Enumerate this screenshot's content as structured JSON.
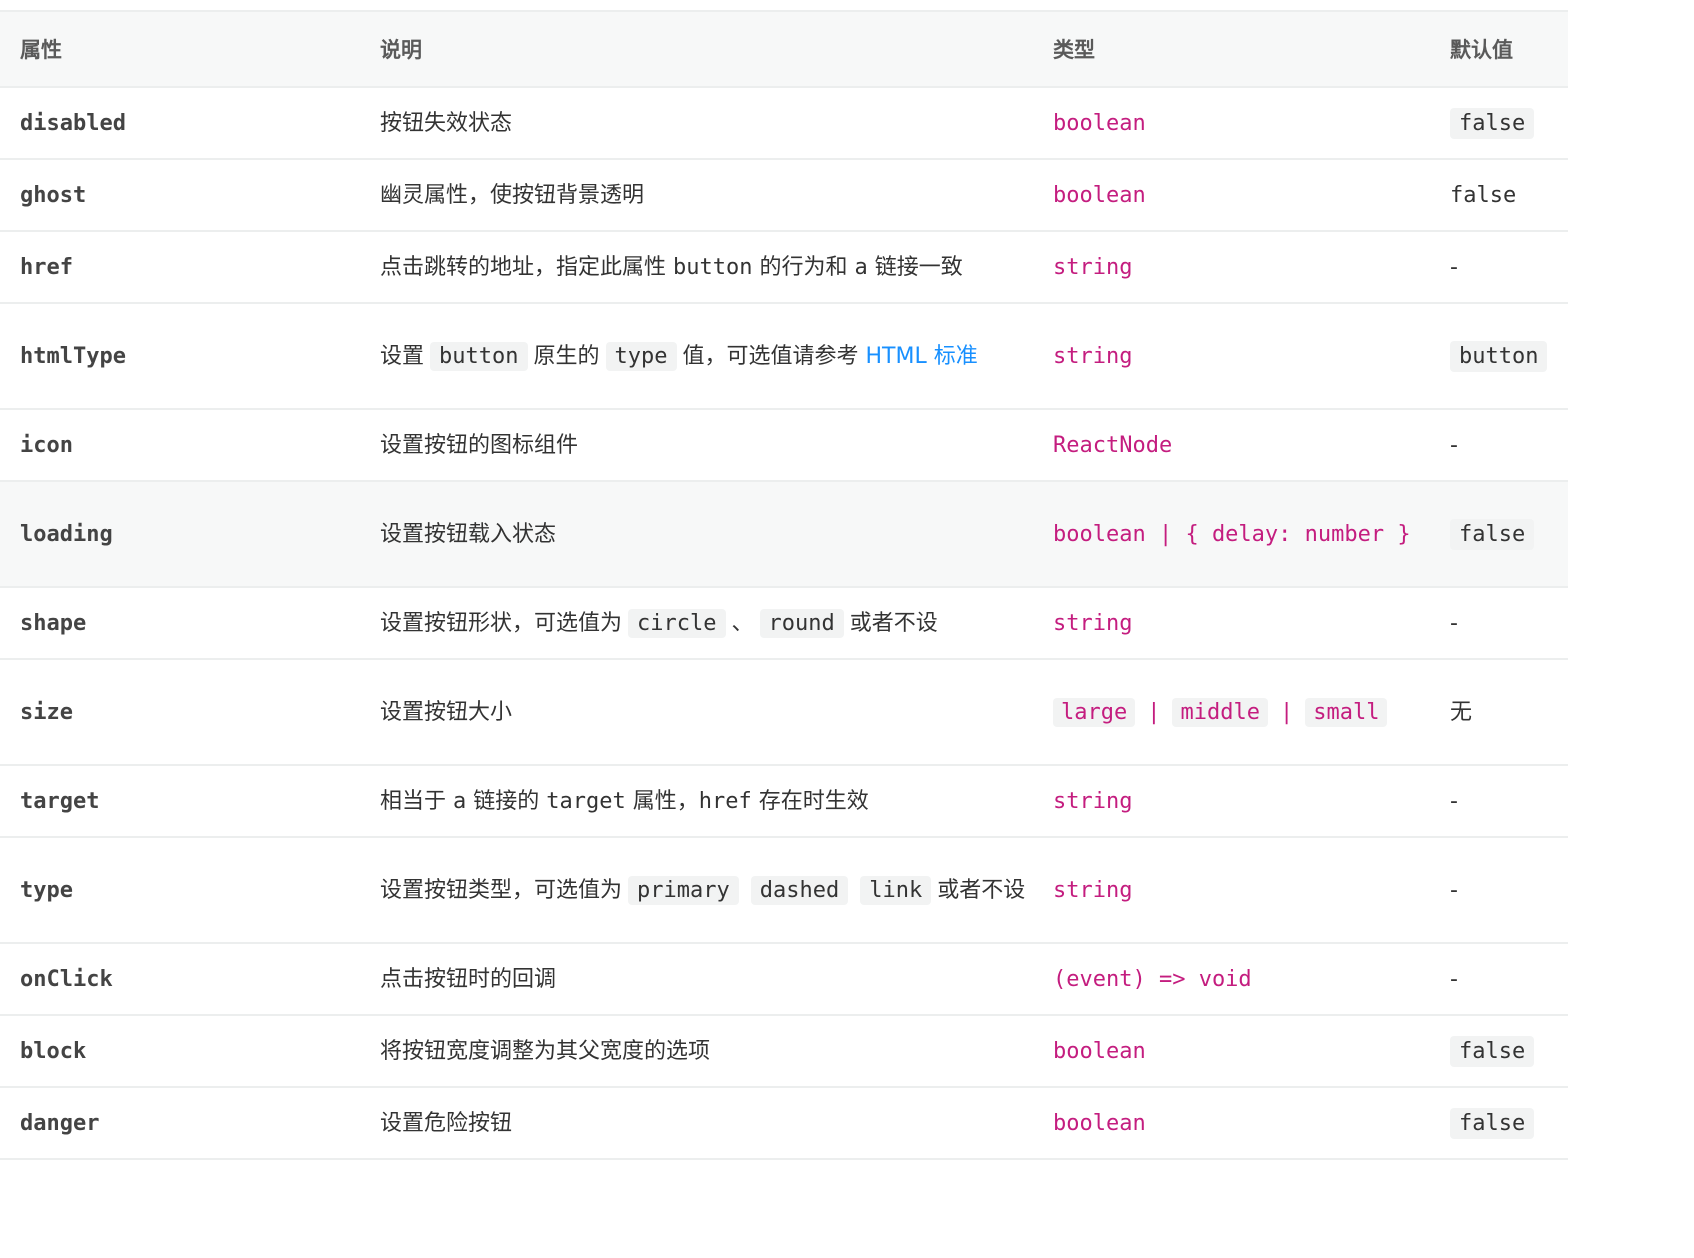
{
  "table": {
    "headers": {
      "property": "属性",
      "description": "说明",
      "type": "类型",
      "default": "默认值"
    },
    "rows": [
      {
        "name": "disabled",
        "desc": "按钮失效状态",
        "type": "boolean",
        "default": "false"
      },
      {
        "name": "ghost",
        "desc": "幽灵属性，使按钮背景透明",
        "type": "boolean",
        "default": "false"
      },
      {
        "name": "href",
        "desc": {
          "t1": "点击跳转的地址，指定此属性 ",
          "c1": "button",
          "t2": " 的行为和 ",
          "c2": "a",
          "t3": " 链接一致"
        },
        "type": "string",
        "default": "-"
      },
      {
        "name": "htmlType",
        "desc": {
          "t1": "设置",
          "c1": "button",
          "t2": "原生的",
          "c2": "type",
          "t3": "值，可选值请参考 ",
          "link": "HTML 标准"
        },
        "type": "string",
        "default": "button"
      },
      {
        "name": "icon",
        "desc": "设置按钮的图标组件",
        "type": "ReactNode",
        "default": "-"
      },
      {
        "name": "loading",
        "desc": "设置按钮载入状态",
        "type": "boolean | { delay: number }",
        "default": "false"
      },
      {
        "name": "shape",
        "desc": {
          "t1": "设置按钮形状，可选值为",
          "c1": "circle",
          "t2": "、",
          "c2": "round",
          "t3": "或者不设"
        },
        "type": "string",
        "default": "-"
      },
      {
        "name": "size",
        "desc": "设置按钮大小",
        "type_values": [
          "large",
          "middle",
          "small"
        ],
        "type_sep": "|",
        "default": "无"
      },
      {
        "name": "target",
        "desc": {
          "t1": "相当于 ",
          "c1": "a",
          "t2": " 链接的 ",
          "c2": "target",
          "t3": " 属性，",
          "c3": "href",
          "t4": " 存在时生效"
        },
        "type": "string",
        "default": "-"
      },
      {
        "name": "type",
        "desc": {
          "t1": "设置按钮类型，可选值为",
          "c1": "primary",
          "c2": "dashed",
          "c3": "link",
          "t2": "或者不设"
        },
        "type": "string",
        "default": "-"
      },
      {
        "name": "onClick",
        "desc": "点击按钮时的回调",
        "type": "(event) => void",
        "default": "-"
      },
      {
        "name": "block",
        "desc": "将按钮宽度调整为其父宽度的选项",
        "type": "boolean",
        "default": "false"
      },
      {
        "name": "danger",
        "desc": "设置危险按钮",
        "type": "boolean",
        "default": "false"
      }
    ]
  }
}
